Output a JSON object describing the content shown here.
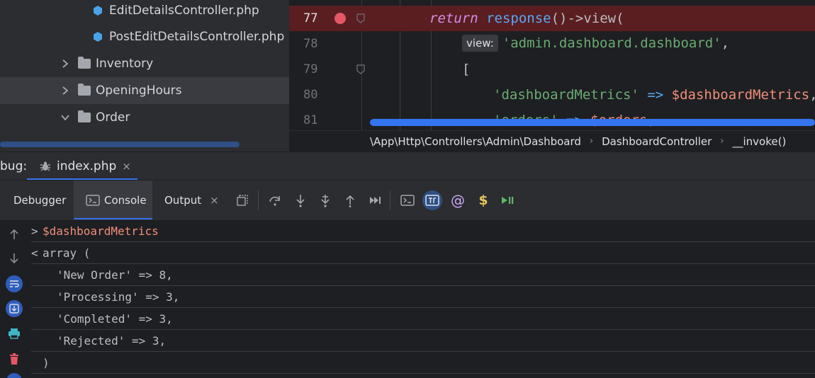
{
  "project_tree": {
    "files": [
      {
        "name": "EditDetailsController.php"
      },
      {
        "name": "PostEditDetailsController.php"
      }
    ],
    "folders": [
      {
        "name": "Inventory",
        "expanded": false
      },
      {
        "name": "OpeningHours",
        "expanded": false,
        "selected": true
      },
      {
        "name": "Order",
        "expanded": true
      }
    ]
  },
  "editor": {
    "lines": [
      {
        "number": "77",
        "breakpoint": true,
        "tokens": {
          "kw": "return",
          "fn": "response",
          "rest": "()->view("
        }
      },
      {
        "number": "78",
        "hint": "view:",
        "str": "'admin.dashboard.dashboard'",
        "tail": ","
      },
      {
        "number": "79",
        "text": "["
      },
      {
        "number": "80",
        "str": "'dashboardMetrics'",
        "op": " => ",
        "var": "$dashboardMetrics",
        "tail": ","
      },
      {
        "number": "81",
        "str": "'orders'",
        "op": " => ",
        "var": "$orders",
        "tail": ","
      }
    ]
  },
  "breadcrumb": {
    "namespace": "\\App\\Http\\Controllers\\Admin\\Dashboard",
    "class": "DashboardController",
    "method": "__invoke()"
  },
  "debug": {
    "label": "bug:",
    "tab": "index.php",
    "tab_close": "×"
  },
  "toolbar": {
    "tabs": {
      "debugger": "Debugger",
      "console": "Console",
      "output": "Output",
      "output_close": "×"
    },
    "active_tab": "console"
  },
  "console": {
    "input": {
      "prompt": ">",
      "command": "$dashboardMetrics"
    },
    "output_header": {
      "prompt": "<",
      "text": "array ("
    },
    "entries": [
      "'New Order' => 8,",
      "'Processing' => 3,",
      "'Completed' => 3,",
      "'Rejected' => 3,"
    ],
    "footer": ")"
  },
  "colors": {
    "accent": "#3574f0",
    "breakpoint": "#e55765",
    "breakpoint_line": "#5a1e21",
    "string": "#6aab73",
    "keyword": "#cf8ee5",
    "function": "#56a8f5",
    "variable": "#ef8f7a"
  },
  "icons": {
    "file": "php-class-icon",
    "folder": "folder-icon",
    "tab": "bug-icon"
  }
}
